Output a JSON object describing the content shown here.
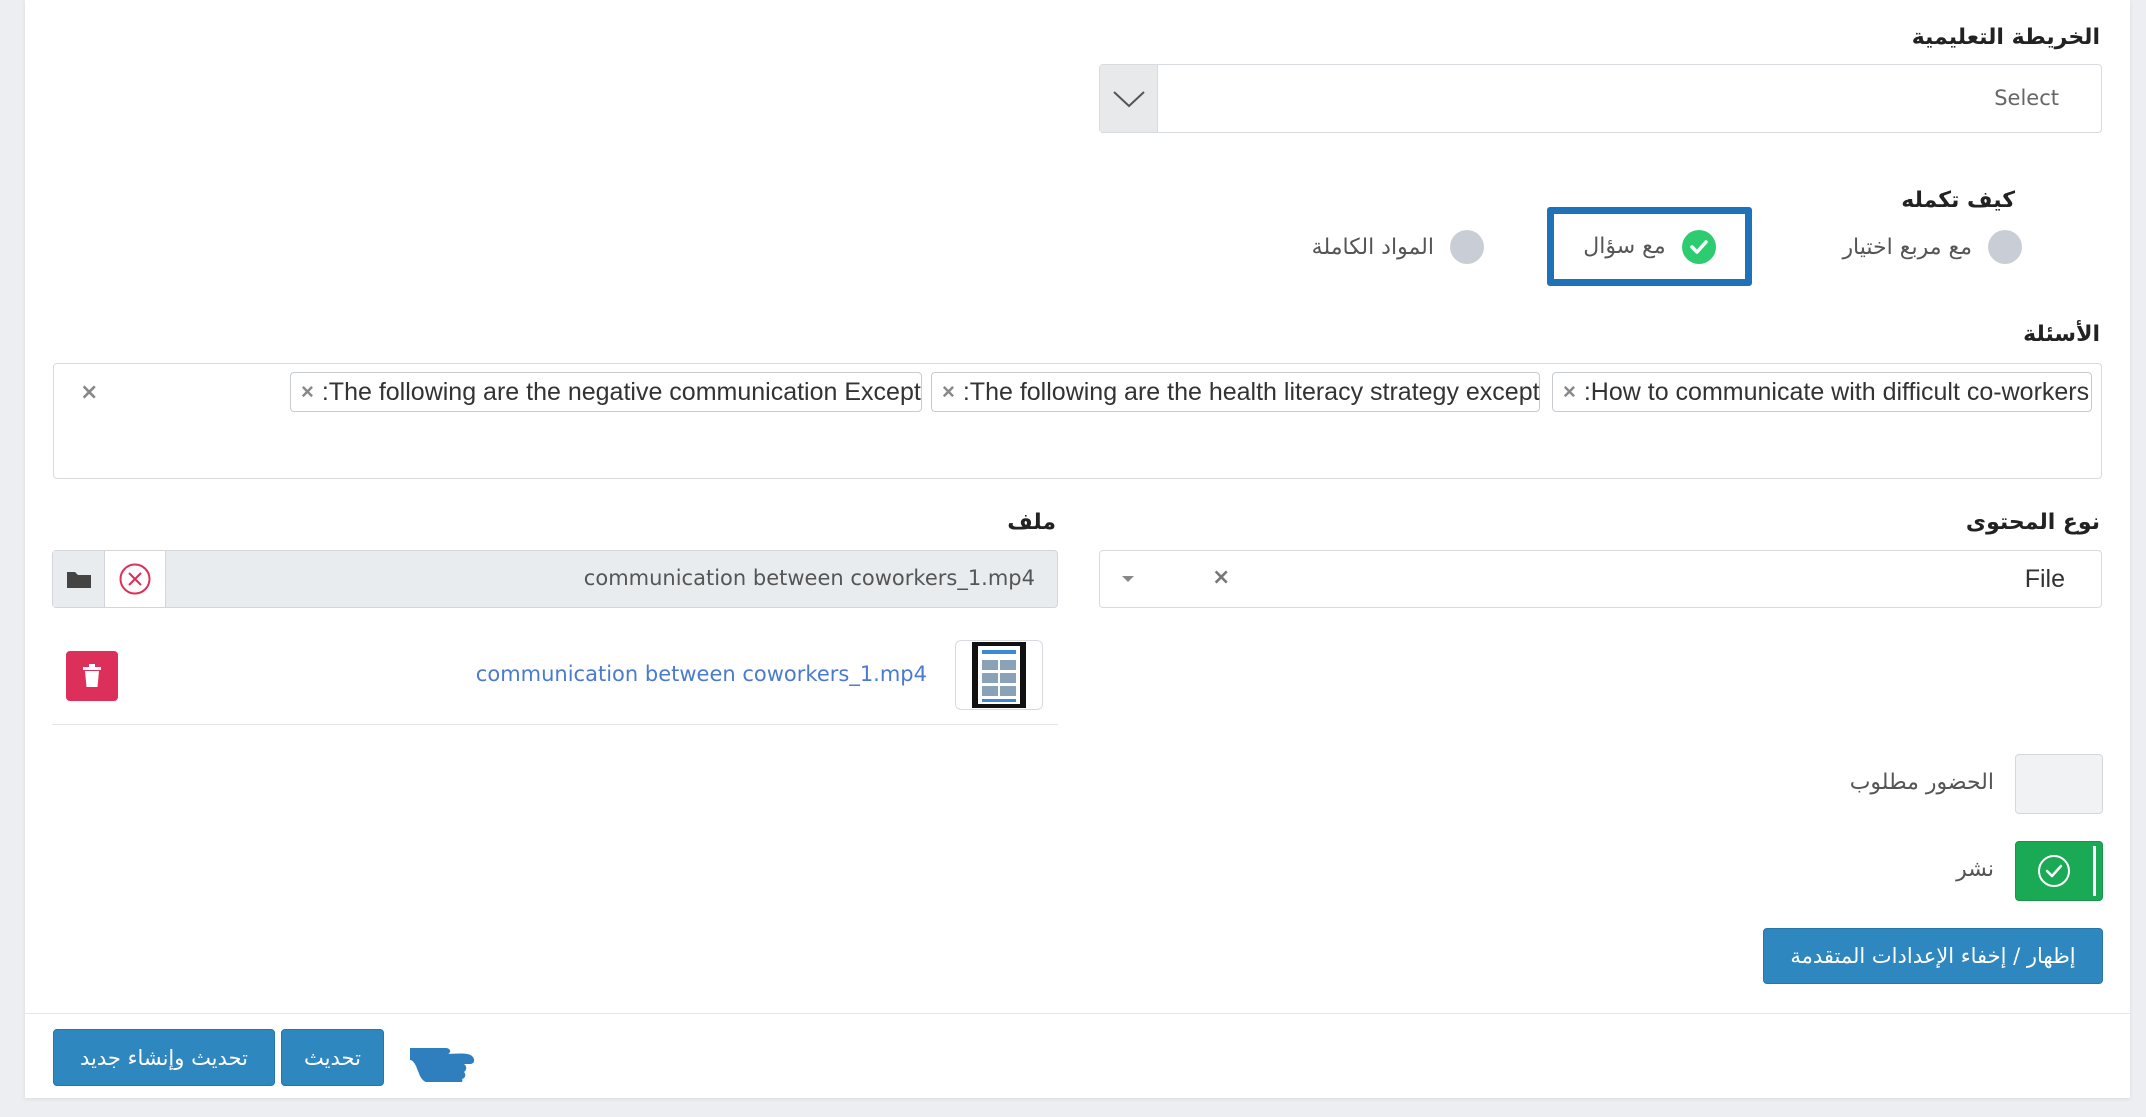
{
  "learning_map": {
    "label": "الخريطة التعليمية",
    "placeholder": "Select"
  },
  "completion": {
    "label": "كيف تكمله",
    "options": [
      {
        "label": "مع مربع اختيار",
        "selected": false
      },
      {
        "label": "مع سؤال",
        "selected": true
      },
      {
        "label": "المواد الكاملة",
        "selected": false
      }
    ]
  },
  "questions": {
    "label": "الأسئلة",
    "tags": [
      ":How to communicate with difficult co-workers",
      ":The following are the health literacy strategy except",
      ":The following are the negative communication Except"
    ],
    "remove_glyph": "×",
    "clear_glyph": "×"
  },
  "content_type": {
    "label": "نوع المحتوى",
    "value": "File",
    "clear_glyph": "×"
  },
  "file": {
    "label": "ملف",
    "input_value": "communication between coworkers_1.mp4",
    "link_text": "communication between coworkers_1.mp4"
  },
  "attendance": {
    "label": "الحضور مطلوب",
    "enabled": false
  },
  "publish": {
    "label": "نشر",
    "enabled": true
  },
  "advanced_button": "إظهار / إخفاء الإعدادات المتقدمة",
  "footer": {
    "update_create_new": "تحديث وإنشاء جديد",
    "update": "تحديث"
  },
  "colors": {
    "primary": "#2f87c0",
    "success": "#1aaa55",
    "danger": "#dc2f5a",
    "highlight_border": "#1f72b8"
  }
}
